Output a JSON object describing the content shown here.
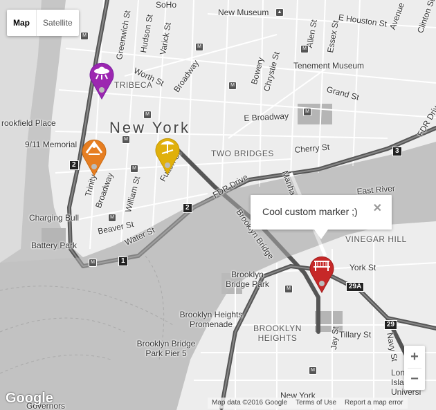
{
  "controls": {
    "map_label": "Map",
    "satellite_label": "Satellite",
    "zoom_in": "+",
    "zoom_out": "−"
  },
  "info_window": {
    "text": "Cool custom marker ;)",
    "close": "✕"
  },
  "markers": [
    {
      "name": "purple-marker",
      "color": "#9c27b0",
      "icon": "ufo-icon"
    },
    {
      "name": "orange-marker",
      "color": "#e67e22",
      "icon": "playground-icon"
    },
    {
      "name": "yellow-marker",
      "color": "#e0b00b",
      "icon": "beach-icon"
    },
    {
      "name": "red-marker",
      "color": "#c62828",
      "icon": "bridge-icon"
    }
  ],
  "labels": {
    "new_york": "New York",
    "tribeca": "TRIBECA",
    "two_bridges": "TWO BRIDGES",
    "vinegar_hill": "VINEGAR HILL",
    "brooklyn_heights": "BROOKLYN HEIGHTS",
    "new_museum": "New Museum",
    "tenement_museum": "Tenement Museum",
    "brookfield_place": "rookfield Place",
    "memorial": "9/11 Memorial",
    "charging_bull": "Charging Bull",
    "battery_park": "Battery Park",
    "brooklyn_bridge_park": "Brooklyn Bridge Park",
    "brooklyn_heights_promenade": "Brooklyn Heights Promenade",
    "pier5": "Brooklyn Bridge Park Pier 5",
    "long_island_univ": "Long Islan Universi",
    "governors": "Governors",
    "e_houston": "E Houston St",
    "grand_st": "Grand St",
    "e_broadway": "E Broadway",
    "cherry_st": "Cherry St",
    "east_river": "East River",
    "fdr_drive": "FDR Drive",
    "fdr_drive_2": "FDR Drive",
    "york_st": "York St",
    "tillary_st": "Tillary St",
    "jay_st": "Jay St",
    "new_york_ave": "New York",
    "beaver_st": "Beaver St",
    "water_st": "Water St",
    "broadway": "Broadway",
    "broadway_2": "Broadway",
    "hudson_st": "Hudson St",
    "varick_st": "Varick St",
    "worth_st": "Worth St",
    "greenwich_st": "Greenwich St",
    "bowery": "Bowery",
    "chrystie_st": "Chrystie St",
    "allen_st": "Allen St",
    "essex_st": "Essex St",
    "trinity_pl": "Trinity Pl",
    "william_st": "William St",
    "fulton_st": "Fulton St",
    "brooklyn_bridge": "Brooklyn Bridge",
    "manhattan_br": "Manha",
    "avenue_a": "Avenue",
    "clinton_st": "Clinton St",
    "navy_st": "Navy St",
    "soho": "SoHo"
  },
  "shields": [
    "2",
    "3",
    "2",
    "1",
    "29A",
    "29"
  ],
  "attribution": {
    "logo": "Google",
    "map_data": "Map data ©2016 Google",
    "terms": "Terms of Use",
    "report": "Report a map error"
  }
}
